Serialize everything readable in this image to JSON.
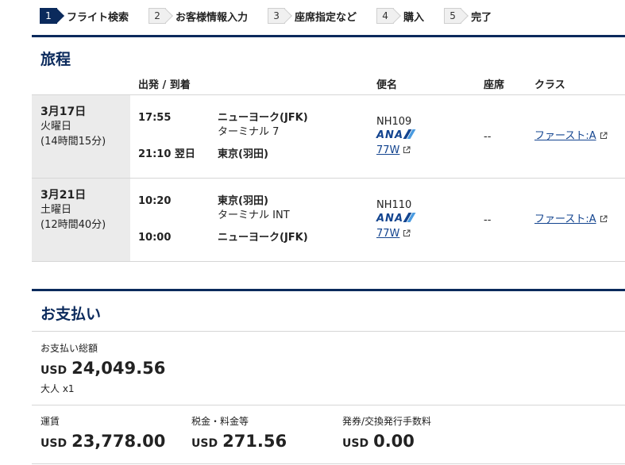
{
  "steps": [
    {
      "num": "1",
      "label": "フライト検索",
      "active": true
    },
    {
      "num": "2",
      "label": "お客様情報入力",
      "active": false
    },
    {
      "num": "3",
      "label": "座席指定など",
      "active": false
    },
    {
      "num": "4",
      "label": "購入",
      "active": false
    },
    {
      "num": "5",
      "label": "完了",
      "active": false
    }
  ],
  "itinerary": {
    "title": "旅程",
    "headers": {
      "dep_arr": "出発 / 到着",
      "flight": "便名",
      "seat": "座席",
      "class": "クラス"
    },
    "segments": [
      {
        "date": "3月17日",
        "weekday": "火曜日",
        "duration": "(14時間15分)",
        "dep_time": "17:55",
        "dep_place": "ニューヨーク(JFK)",
        "dep_terminal": "ターミナル 7",
        "arr_time": "21:10 翌日",
        "arr_place": "東京(羽田)",
        "flight_no": "NH109",
        "airline_logo_text": "ANA",
        "aircraft": "77W",
        "seat": "--",
        "cabin": "ファースト:A"
      },
      {
        "date": "3月21日",
        "weekday": "土曜日",
        "duration": "(12時間40分)",
        "dep_time": "10:20",
        "dep_place": "東京(羽田)",
        "dep_terminal": "ターミナル INT",
        "arr_time": "10:00",
        "arr_place": "ニューヨーク(JFK)",
        "flight_no": "NH110",
        "airline_logo_text": "ANA",
        "aircraft": "77W",
        "seat": "--",
        "cabin": "ファースト:A"
      }
    ]
  },
  "payment": {
    "title": "お支払い",
    "total_label": "お支払い総額",
    "currency": "USD",
    "total": "24,049.56",
    "passengers": "大人 x1",
    "breakdown": [
      {
        "label": "運賃",
        "currency": "USD",
        "value": "23,778.00"
      },
      {
        "label": "税金・料金等",
        "currency": "USD",
        "value": "271.56"
      },
      {
        "label": "発券/交換発行手数料",
        "currency": "USD",
        "value": "0.00"
      }
    ]
  },
  "colors": {
    "brand_navy": "#0b2a5c",
    "ana_blue": "#13448f",
    "link": "#13448f"
  },
  "icons": {
    "external_link": "external-link-icon"
  }
}
